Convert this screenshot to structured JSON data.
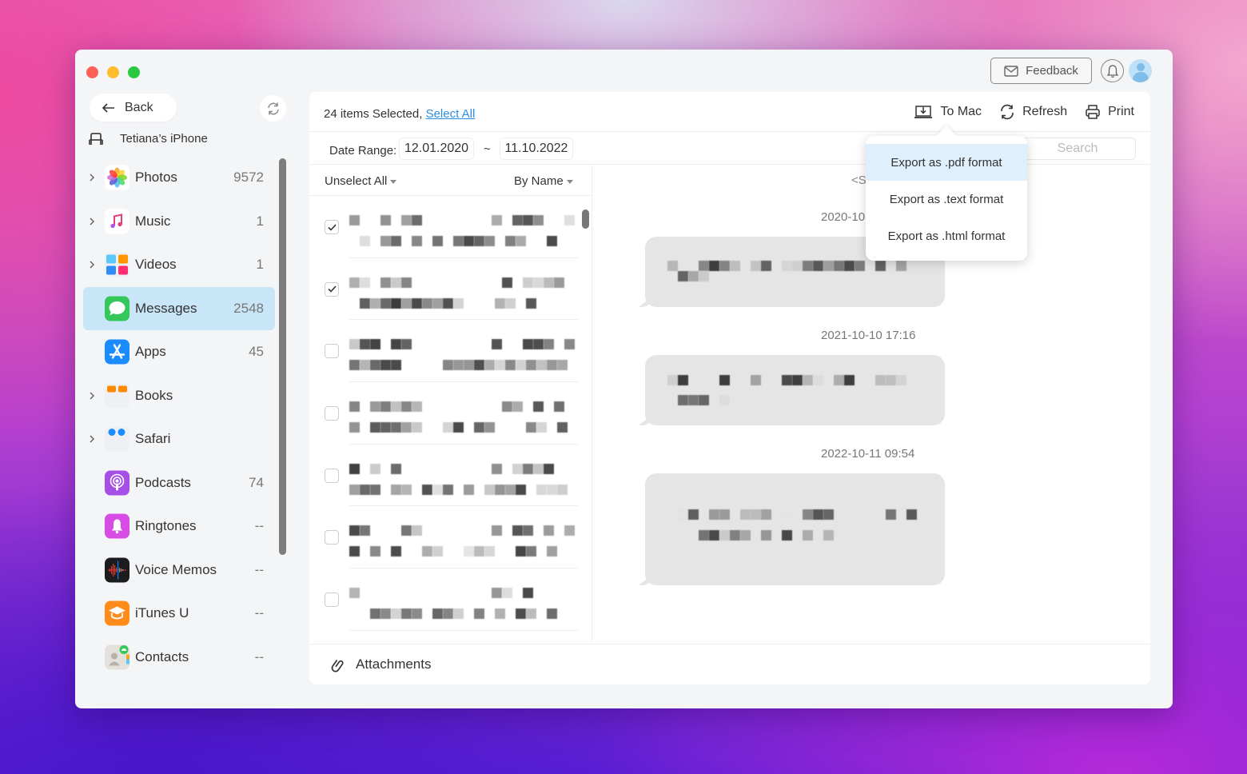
{
  "window": {
    "header": {
      "feedback_label": "Feedback",
      "feedback_icon": "mail-icon",
      "bell_icon": "bell-icon",
      "avatar_icon": "user-avatar-icon"
    },
    "back_label": "Back",
    "device_name": "Tetiana’s iPhone"
  },
  "sidebar": {
    "items": [
      {
        "label": "Photos",
        "count": "9572",
        "expandable": true,
        "icon": "photos-icon"
      },
      {
        "label": "Music",
        "count": "1",
        "expandable": true,
        "icon": "music-icon"
      },
      {
        "label": "Videos",
        "count": "1",
        "expandable": true,
        "icon": "videos-icon"
      },
      {
        "label": "Messages",
        "count": "2548",
        "expandable": false,
        "icon": "messages-icon",
        "active": true
      },
      {
        "label": "Apps",
        "count": "45",
        "expandable": false,
        "icon": "app-store-icon"
      },
      {
        "label": "Books",
        "count": "",
        "expandable": true,
        "icon": "books-icon"
      },
      {
        "label": "Safari",
        "count": "",
        "expandable": true,
        "icon": "safari-icon"
      },
      {
        "label": "Podcasts",
        "count": "74",
        "expandable": false,
        "icon": "podcasts-icon"
      },
      {
        "label": "Ringtones",
        "count": "--",
        "expandable": false,
        "icon": "ringtones-icon"
      },
      {
        "label": "Voice Memos",
        "count": "--",
        "expandable": false,
        "icon": "voice-memos-icon"
      },
      {
        "label": "iTunes U",
        "count": "--",
        "expandable": false,
        "icon": "itunes-u-icon"
      },
      {
        "label": "Contacts",
        "count": "--",
        "expandable": false,
        "icon": "contacts-icon"
      }
    ]
  },
  "toolbar": {
    "selection_text": "24 items Selected,",
    "select_all_label": "Select All",
    "to_mac_label": "To Mac",
    "refresh_label": "Refresh",
    "print_label": "Print"
  },
  "filter": {
    "date_range_label": "Date Range:",
    "date_from": "12.01.2020",
    "separator": "~",
    "date_to": "11.10.2022",
    "search_placeholder": "Search"
  },
  "list": {
    "unselect_all_label": "Unselect All",
    "sort_label": "By Name",
    "rows": [
      {
        "checked": true
      },
      {
        "checked": true
      },
      {
        "checked": false
      },
      {
        "checked": false
      },
      {
        "checked": false
      },
      {
        "checked": false
      },
      {
        "checked": false
      }
    ]
  },
  "chat": {
    "header_partial": "<S",
    "messages": [
      {
        "timestamp": "2020-10",
        "content": "[redacted]"
      },
      {
        "timestamp": "2021-10-10 17:16",
        "content": "[redacted]"
      },
      {
        "timestamp": "2022-10-11 09:54",
        "content": "[redacted]"
      }
    ]
  },
  "attachments_label": "Attachments",
  "export_menu": {
    "items": [
      {
        "label": "Export as .pdf format",
        "highlighted": true
      },
      {
        "label": "Export as .text format",
        "highlighted": false
      },
      {
        "label": "Export as .html format",
        "highlighted": false
      }
    ]
  }
}
